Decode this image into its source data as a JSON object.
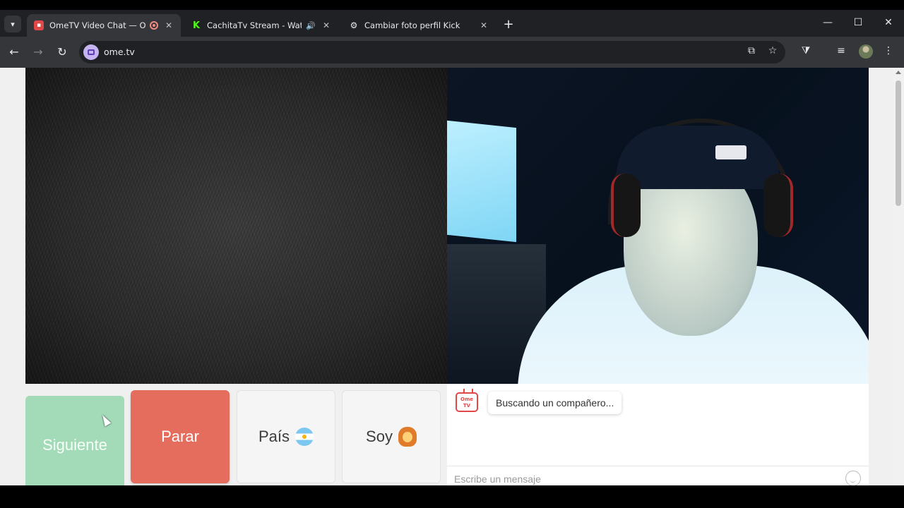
{
  "browser": {
    "tabs": [
      {
        "title": "OmeTV Video Chat — Ome",
        "active": true,
        "favicon": "ometv-favicon",
        "indicator": "recording-icon"
      },
      {
        "title": "CachitaTv Stream - Watch L",
        "active": false,
        "favicon": "kick-favicon",
        "indicator": "speaker-icon"
      },
      {
        "title": "Cambiar foto perfil Kick",
        "active": false,
        "favicon": "chatgpt-favicon",
        "indicator": ""
      }
    ],
    "new_tab_label": "+",
    "url": "ome.tv",
    "icons": {
      "back": "back-arrow-icon",
      "forward": "forward-arrow-icon",
      "reload": "reload-icon",
      "install": "install-app-icon",
      "bookmark": "bookmark-star-icon",
      "extensions": "extensions-icon",
      "media": "media-controls-icon"
    }
  },
  "controls": {
    "next_label": "Siguiente",
    "stop_label": "Parar",
    "country_label": "País",
    "gender_label": "Soy",
    "colors": {
      "next": "#a3dbb8",
      "stop": "#e56d5d",
      "neutral": "#f5f5f5"
    }
  },
  "chat": {
    "logo_text": "Ome TV",
    "status_message": "Buscando un compañero...",
    "input_placeholder": "Escribe un mensaje"
  }
}
